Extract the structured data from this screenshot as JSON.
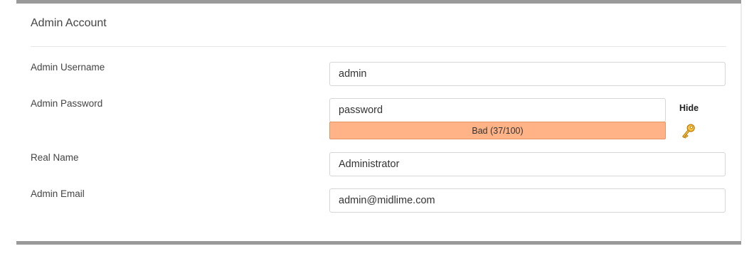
{
  "section": {
    "title": "Admin Account"
  },
  "fields": {
    "username": {
      "label": "Admin Username",
      "value": "admin"
    },
    "password": {
      "label": "Admin Password",
      "value": "password"
    },
    "realname": {
      "label": "Real Name",
      "value": "Administrator"
    },
    "email": {
      "label": "Admin Email",
      "value": "admin@midlime.com"
    }
  },
  "password_strength": {
    "text": "Bad (37/100)",
    "score": 37,
    "max": 100,
    "color": "#ffb386"
  },
  "password_tools": {
    "hide_label": "Hide",
    "generate_icon": "key-icon"
  },
  "colors": {
    "panel_border": "#999999",
    "label_text": "#444444",
    "field_border": "#d6d6d6",
    "key_icon": "#e8a317"
  }
}
